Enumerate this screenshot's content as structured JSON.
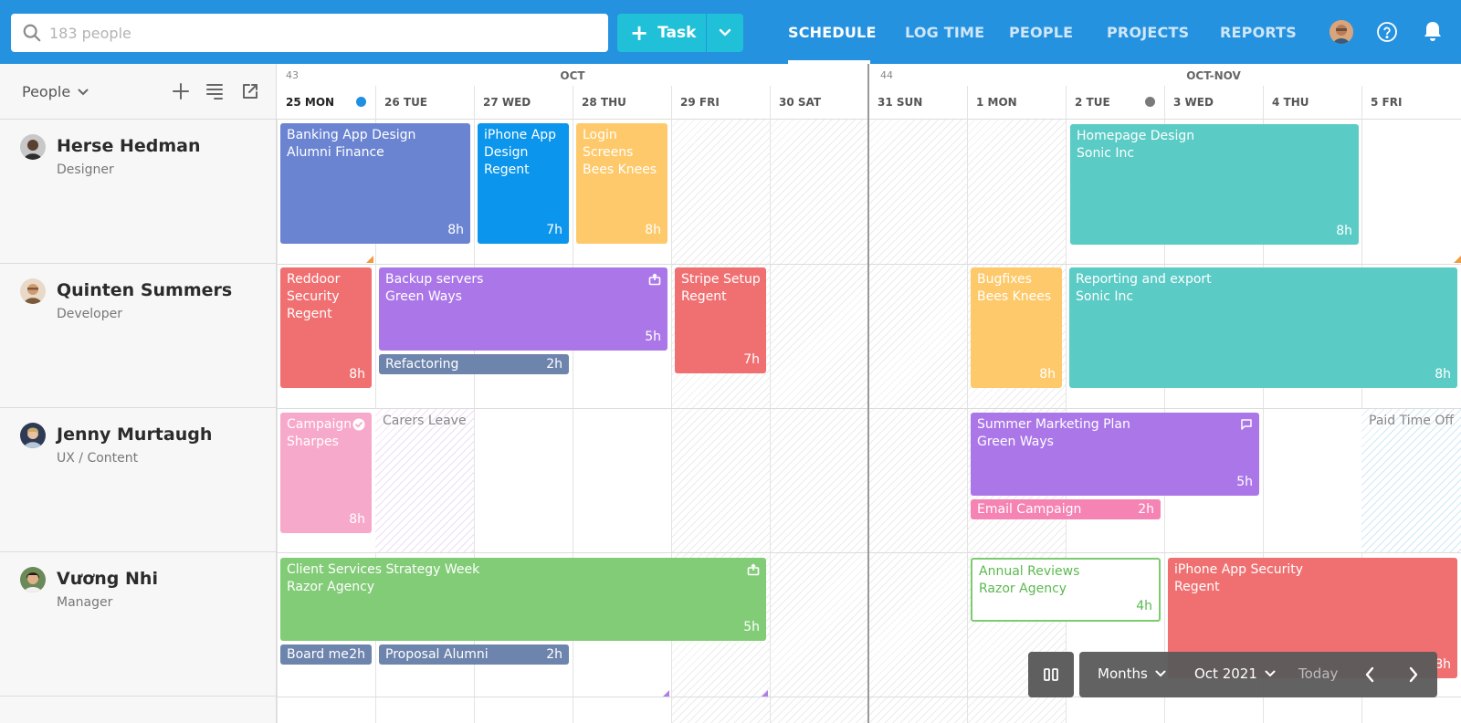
{
  "search": {
    "placeholder": "183 people"
  },
  "task_button": {
    "label": "Task"
  },
  "nav": {
    "items": [
      {
        "label": "SCHEDULE",
        "active": true
      },
      {
        "label": "LOG TIME"
      },
      {
        "label": "PEOPLE"
      },
      {
        "label": "PROJECTS"
      },
      {
        "label": "REPORTS"
      }
    ]
  },
  "sidebar": {
    "people_label": "People"
  },
  "people": [
    {
      "name": "Herse Hedman",
      "role": "Designer"
    },
    {
      "name": "Quinten Summers",
      "role": "Developer"
    },
    {
      "name": "Jenny Murtaugh",
      "role": "UX / Content"
    },
    {
      "name": "Vương Nhi",
      "role": "Manager"
    }
  ],
  "calendar": {
    "weeks": [
      {
        "number": "43",
        "month": "OCT"
      },
      {
        "number": "44",
        "month": "OCT-NOV"
      }
    ],
    "days": [
      "25 MON",
      "26 TUE",
      "27 WED",
      "28 THU",
      "29 FRI",
      "30 SAT",
      "31 SUN",
      "1 MON",
      "2 TUE",
      "3 WED",
      "4 THU",
      "5 FRI"
    ]
  },
  "tasks": {
    "banking": {
      "title": "Banking App Design",
      "client": "Alumni Finance",
      "hours": "8h"
    },
    "iphone_design": {
      "title": "iPhone App Design",
      "client": "Regent",
      "hours": "7h"
    },
    "login": {
      "title": "Login Screens",
      "client": "Bees Knees",
      "hours": "8h"
    },
    "homepage": {
      "title": "Homepage Design",
      "client": "Sonic Inc",
      "hours": "8h"
    },
    "reddoor": {
      "title": "Reddoor Security",
      "client": "Regent",
      "hours": "8h"
    },
    "backup": {
      "title": "Backup servers",
      "client": "Green Ways",
      "hours": "5h"
    },
    "refactoring": {
      "title": "Refactoring",
      "hours": "2h"
    },
    "stripe": {
      "title": "Stripe Setup",
      "client": "Regent",
      "hours": "7h"
    },
    "bugfixes": {
      "title": "Bugfixes",
      "client": "Bees Knees",
      "hours": "8h"
    },
    "reporting": {
      "title": "Reporting and export",
      "client": "Sonic Inc",
      "hours": "8h"
    },
    "campaign": {
      "title": "Campaign",
      "client": "Sharpes",
      "hours": "8h"
    },
    "summer": {
      "title": "Summer Marketing Plan",
      "client": "Green Ways",
      "hours": "5h"
    },
    "email": {
      "title": "Email Campaign",
      "hours": "2h"
    },
    "client_services": {
      "title": "Client Services Strategy Week",
      "client": "Razor Agency",
      "hours": "5h"
    },
    "board": {
      "title": "Board me",
      "hours": "2h"
    },
    "proposal": {
      "title": "Proposal Alumni",
      "hours": "2h"
    },
    "annual": {
      "title": "Annual Reviews",
      "client": "Razor Agency",
      "hours": "4h"
    },
    "iphone_security": {
      "title": "iPhone App Security",
      "client": "Regent",
      "hours": "8h"
    }
  },
  "leaves": {
    "carers": "Carers Leave",
    "paid": "Paid Time Off"
  },
  "controls": {
    "view": "Months",
    "period": "Oct 2021",
    "today": "Today"
  },
  "colors": {
    "topbar": "#2592e0",
    "task_button": "#20c0d8",
    "blue_violet": "#6a84d2",
    "blue": "#0b95ec",
    "yellow": "#fec96a",
    "teal": "#5bcbc5",
    "red": "#f07072",
    "purple": "#ab77e8",
    "slate": "#6d84ad",
    "pink": "#f7a9cb",
    "hot_pink": "#f583b3",
    "green": "#82cc77"
  }
}
